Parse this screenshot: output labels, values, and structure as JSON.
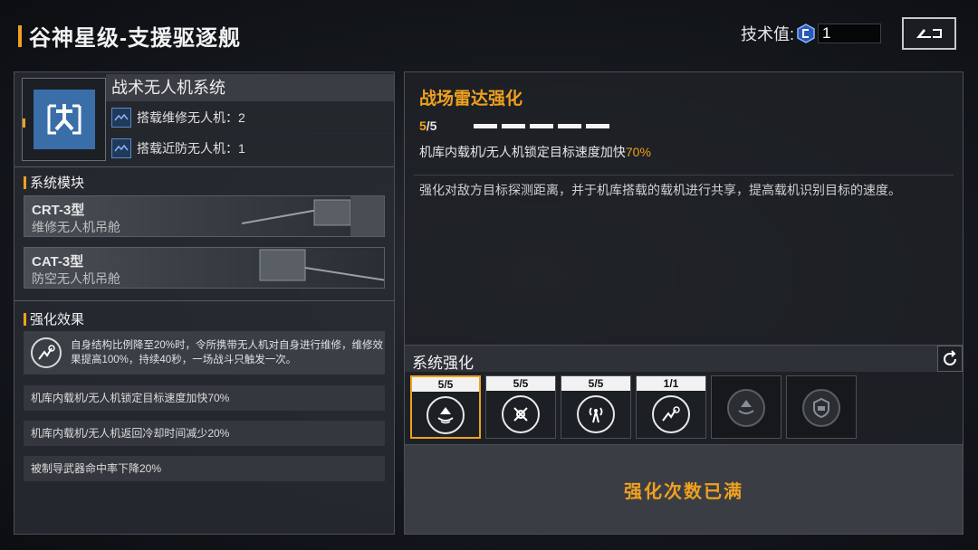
{
  "header": {
    "title": "谷神星级-支援驱逐舰",
    "tech_label": "技术值:",
    "tech_value": "1"
  },
  "system": {
    "name": "战术无人机系统",
    "drones": [
      {
        "label": "搭载维修无人机：2",
        "icon": "drone-icon"
      },
      {
        "label": "搭载近防无人机：1",
        "icon": "drone-icon"
      }
    ]
  },
  "modules": {
    "heading": "系统模块",
    "items": [
      {
        "name": "CRT-3型",
        "desc": "维修无人机吊舱"
      },
      {
        "name": "CAT-3型",
        "desc": "防空无人机吊舱"
      }
    ]
  },
  "effects": {
    "heading": "强化效果",
    "main": "自身结构比例降至20%时，令所携带无人机对自身进行维修，维修效果提高100%，持续40秒，一场战斗只触发一次。",
    "list": [
      "机库内载机/无人机锁定目标速度加快70%",
      "机库内载机/无人机返回冷却时间减少20%",
      "被制导武器命中率下降20%"
    ]
  },
  "detail": {
    "title": "战场雷达强化",
    "progress_current": "5",
    "progress_total": "/5",
    "level": 5,
    "max_level": 5,
    "effect_prefix": "机库内载机/无人机锁定目标速度加快",
    "effect_value": "70%",
    "description": "强化对敌方目标探测距离，并于机库搭载的载机进行共享，提高载机识别目标的速度。"
  },
  "enhance": {
    "heading": "系统强化",
    "slots": [
      {
        "count": "5/5",
        "icon": "radar-boost-icon",
        "selected": true
      },
      {
        "count": "5/5",
        "icon": "drone-recall-icon",
        "selected": false
      },
      {
        "count": "5/5",
        "icon": "signal-tower-icon",
        "selected": false
      },
      {
        "count": "1/1",
        "icon": "repair-drone-icon",
        "selected": false
      },
      {
        "count": "",
        "icon": "locked-radar-icon",
        "locked": true
      },
      {
        "count": "",
        "icon": "locked-shield-icon",
        "locked": true
      }
    ],
    "status": "强化次数已满"
  },
  "colors": {
    "accent": "#f0a020",
    "panel": "#2a2e34",
    "icon_blue": "#3a6ea8"
  }
}
